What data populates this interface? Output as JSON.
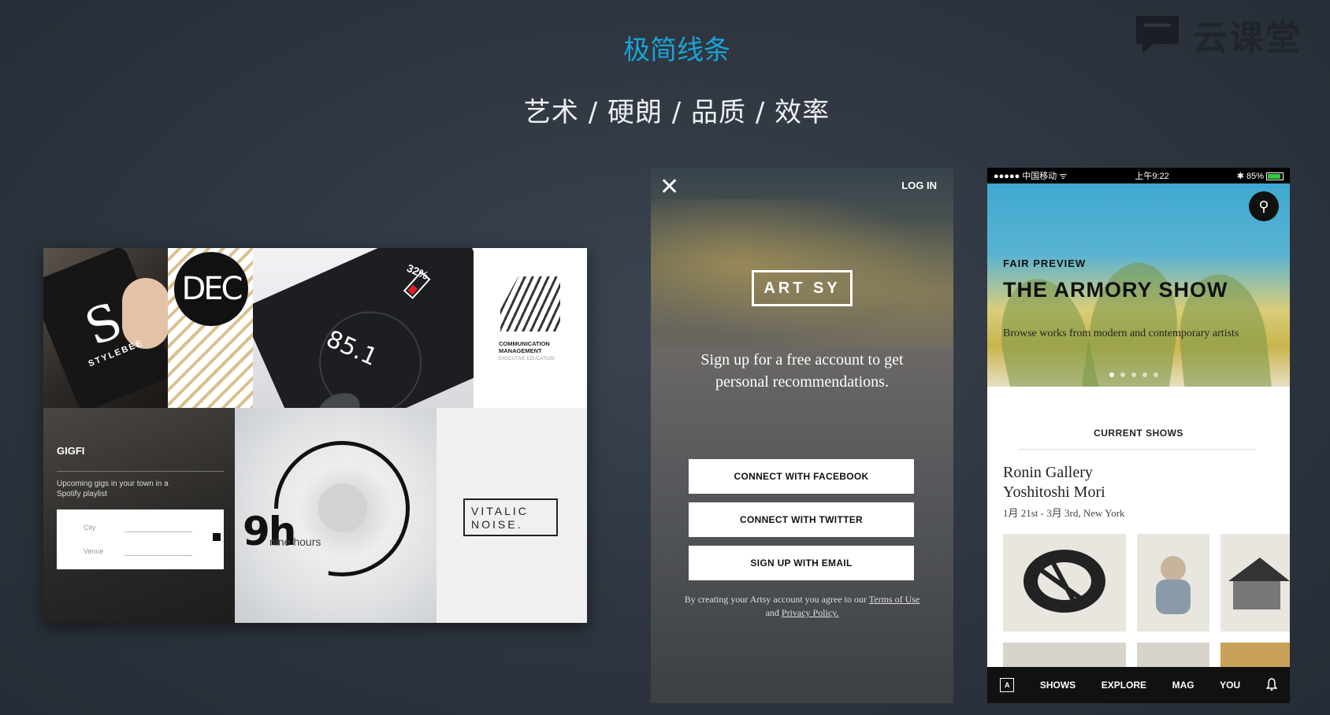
{
  "slide": {
    "title": "极简线条",
    "subtitle": "艺术 / 硬朗 / 品质 / 效率"
  },
  "brand": {
    "name": "云课堂",
    "icon": "chat-bubble-icon"
  },
  "collage": {
    "stylebee": {
      "mark": "S",
      "word": "STYLEBEE"
    },
    "dec": {
      "label": "DEC"
    },
    "watch": {
      "value": "85.1",
      "percent": "32%"
    },
    "communication": {
      "title": "COMMUNICATION MANAGEMENT",
      "subtitle": "EXECUTIVE EDUCATION"
    },
    "gigs": {
      "brand": "GIGFI",
      "text": "Upcoming gigs in your town in a Spotify playlist",
      "city_label": "City",
      "venue_label": "Venue"
    },
    "nine_hours": {
      "big": "9h",
      "small": "nine hours"
    },
    "vitalic": {
      "line1": "VITALIC",
      "line2": "NOISE."
    }
  },
  "artsy": {
    "close_icon": "close-icon",
    "login_label": "LOG IN",
    "logo": "ART SY",
    "pitch": "Sign up for a free account to get personal recommendations.",
    "buttons": {
      "facebook": "CONNECT WITH FACEBOOK",
      "twitter": "CONNECT WITH TWITTER",
      "email": "SIGN UP WITH EMAIL"
    },
    "legal_prefix": "By creating your Artsy account you agree to our",
    "terms": "Terms of Use",
    "and": "and",
    "privacy": "Privacy Policy."
  },
  "armory": {
    "status": {
      "carrier": "●●●●● 中国移动 ᯤ",
      "time": "上午9:22",
      "battery": "✱ 85%"
    },
    "kicker": "FAIR PREVIEW",
    "show_title": "THE ARMORY SHOW",
    "description": "Browse works from modern and contemporary artists",
    "carousel_active": 1,
    "carousel_total": 5,
    "section_title": "CURRENT SHOWS",
    "gallery_line1": "Ronin Gallery",
    "gallery_line2": "Yoshitoshi Mori",
    "dates": "1月 21st - 3月 3rd, New York",
    "tabs": {
      "home_icon": "artsy-a-icon",
      "shows": "SHOWS",
      "explore": "EXPLORE",
      "mag": "MAG",
      "you": "YOU",
      "bell_icon": "bell-icon"
    }
  },
  "colors": {
    "title_accent": "#1ba3d6",
    "background": "#2e353f"
  }
}
